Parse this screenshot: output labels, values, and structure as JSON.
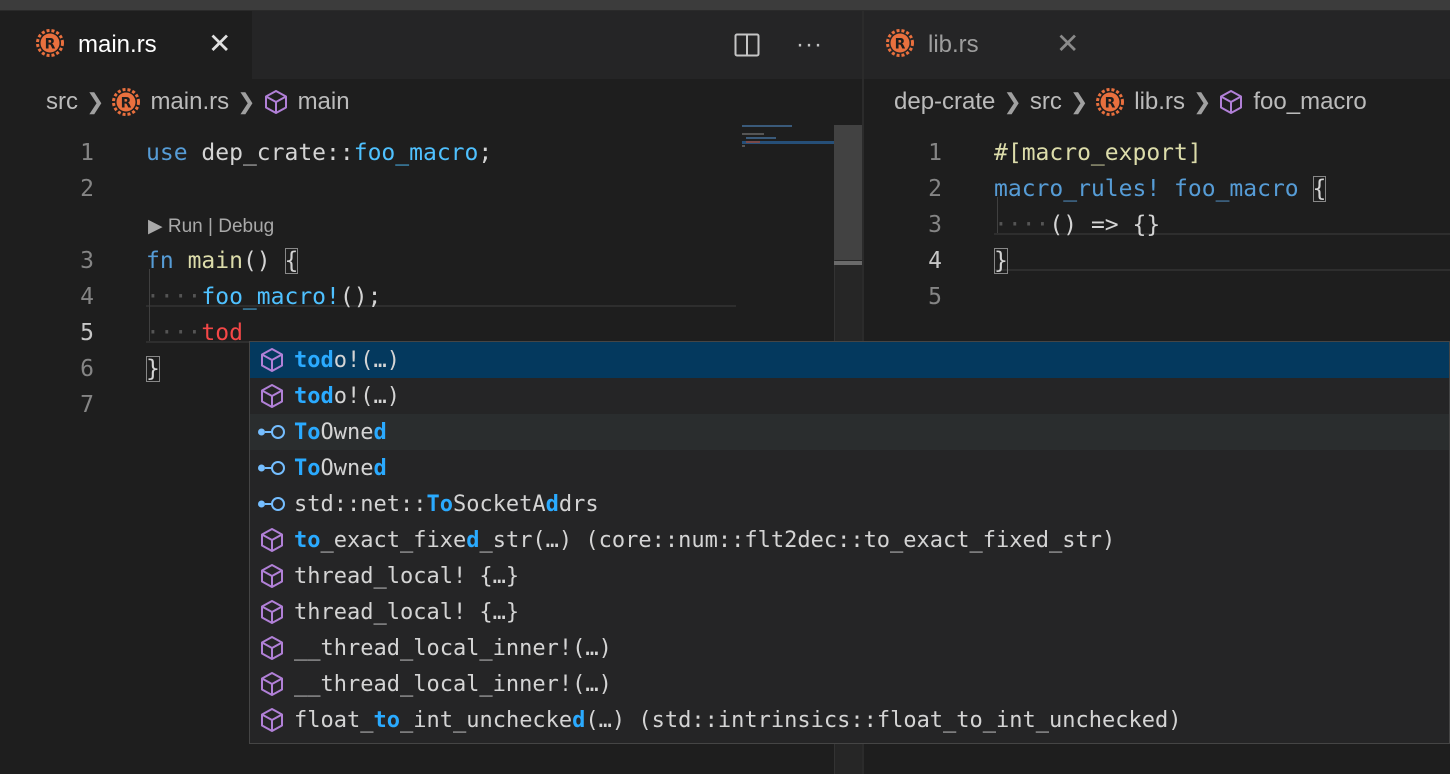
{
  "colors": {
    "rust_icon": "#e9703e",
    "symbol_icon": "#b180d7",
    "interface_icon": "#75beff",
    "match_highlight": "#2aaaff"
  },
  "left": {
    "tab": {
      "label": "main.rs",
      "close": "✕"
    },
    "actions": {
      "split": "split-editor-icon",
      "more": "···"
    },
    "breadcrumb": {
      "folder": "src",
      "file": "main.rs",
      "symbol": "main"
    },
    "lines": [
      {
        "num": "1",
        "tokens": [
          {
            "t": "use",
            "c": "kw"
          },
          {
            "t": " ",
            "c": "id"
          },
          {
            "t": "dep_crate",
            "c": "id"
          },
          {
            "t": "::",
            "c": "id"
          },
          {
            "t": "foo_macro",
            "c": "mac"
          },
          {
            "t": ";",
            "c": "id"
          }
        ]
      },
      {
        "num": "2",
        "tokens": []
      },
      {
        "num": "3",
        "tokens": [
          {
            "t": "fn",
            "c": "kw"
          },
          {
            "t": " ",
            "c": "dots"
          },
          {
            "t": "main",
            "c": "fnn"
          },
          {
            "t": "()",
            "c": "id"
          },
          {
            "t": " ",
            "c": "dots"
          },
          {
            "t": "{",
            "c": "id bracket"
          }
        ]
      },
      {
        "num": "4",
        "tokens": [
          {
            "t": "····",
            "c": "dots"
          },
          {
            "t": "foo_macro!",
            "c": "mac"
          },
          {
            "t": "();",
            "c": "id"
          }
        ]
      },
      {
        "num": "5",
        "tokens": [
          {
            "t": "····",
            "c": "dots"
          },
          {
            "t": "tod",
            "c": "typing"
          }
        ]
      },
      {
        "num": "6",
        "tokens": [
          {
            "t": "}",
            "c": "id bracket"
          }
        ]
      },
      {
        "num": "7",
        "tokens": []
      }
    ],
    "codelens": "▶ Run | Debug"
  },
  "right": {
    "tab": {
      "label": "lib.rs",
      "close": "✕"
    },
    "breadcrumb": {
      "crate": "dep-crate",
      "folder": "src",
      "file": "lib.rs",
      "symbol": "foo_macro"
    },
    "lines": [
      {
        "num": "1",
        "tokens": [
          {
            "t": "#[macro_export]",
            "c": "attr"
          }
        ]
      },
      {
        "num": "2",
        "tokens": [
          {
            "t": "macro_rules!",
            "c": "kw"
          },
          {
            "t": " ",
            "c": "dots"
          },
          {
            "t": "foo_macro",
            "c": "kw"
          },
          {
            "t": " ",
            "c": "dots"
          },
          {
            "t": "{",
            "c": "id bracket"
          }
        ]
      },
      {
        "num": "3",
        "tokens": [
          {
            "t": "····",
            "c": "dots"
          },
          {
            "t": "()",
            "c": "id"
          },
          {
            "t": " ",
            "c": "dots"
          },
          {
            "t": "=>",
            "c": "id"
          },
          {
            "t": " ",
            "c": "dots"
          },
          {
            "t": "{}",
            "c": "id"
          }
        ]
      },
      {
        "num": "4",
        "tokens": [
          {
            "t": "}",
            "c": "id bracket"
          }
        ]
      },
      {
        "num": "5",
        "tokens": []
      }
    ]
  },
  "suggestions": [
    {
      "icon": "cube",
      "label": [
        "tod",
        "o!(…)"
      ],
      "state": "selected"
    },
    {
      "icon": "cube",
      "label": [
        "tod",
        "o!(…)"
      ],
      "state": ""
    },
    {
      "icon": "interface",
      "label": [
        "To",
        "Owne",
        "d"
      ],
      "state": "hover"
    },
    {
      "icon": "interface",
      "label": [
        "To",
        "Owne",
        "d"
      ],
      "state": ""
    },
    {
      "icon": "interface",
      "label": [
        "std::net::",
        "To",
        "SocketA",
        "d",
        "drs"
      ],
      "hlmap": [
        0,
        1,
        0,
        1,
        0
      ],
      "state": ""
    },
    {
      "icon": "cube",
      "label": [
        "to",
        "_exact_fixe",
        "d",
        "_str(…)"
      ],
      "detail": " (core::num::flt2dec::to_exact_fixed_str)",
      "state": ""
    },
    {
      "icon": "cube",
      "label": [
        "thread_local! {…}"
      ],
      "hlmap": [
        0
      ],
      "state": ""
    },
    {
      "icon": "cube",
      "label": [
        "thread_local! {…}"
      ],
      "hlmap": [
        0
      ],
      "state": ""
    },
    {
      "icon": "cube",
      "label": [
        "__thread_local_inner!(…)"
      ],
      "hlmap": [
        0
      ],
      "state": ""
    },
    {
      "icon": "cube",
      "label": [
        "__thread_local_inner!(…)"
      ],
      "hlmap": [
        0
      ],
      "state": ""
    },
    {
      "icon": "cube",
      "label": [
        "float_",
        "to",
        "_int_unchecke",
        "d",
        "(…)"
      ],
      "hlmap": [
        0,
        1,
        0,
        1,
        0
      ],
      "detail": " (std::intrinsics::float_to_int_unchecked)",
      "state": ""
    }
  ]
}
